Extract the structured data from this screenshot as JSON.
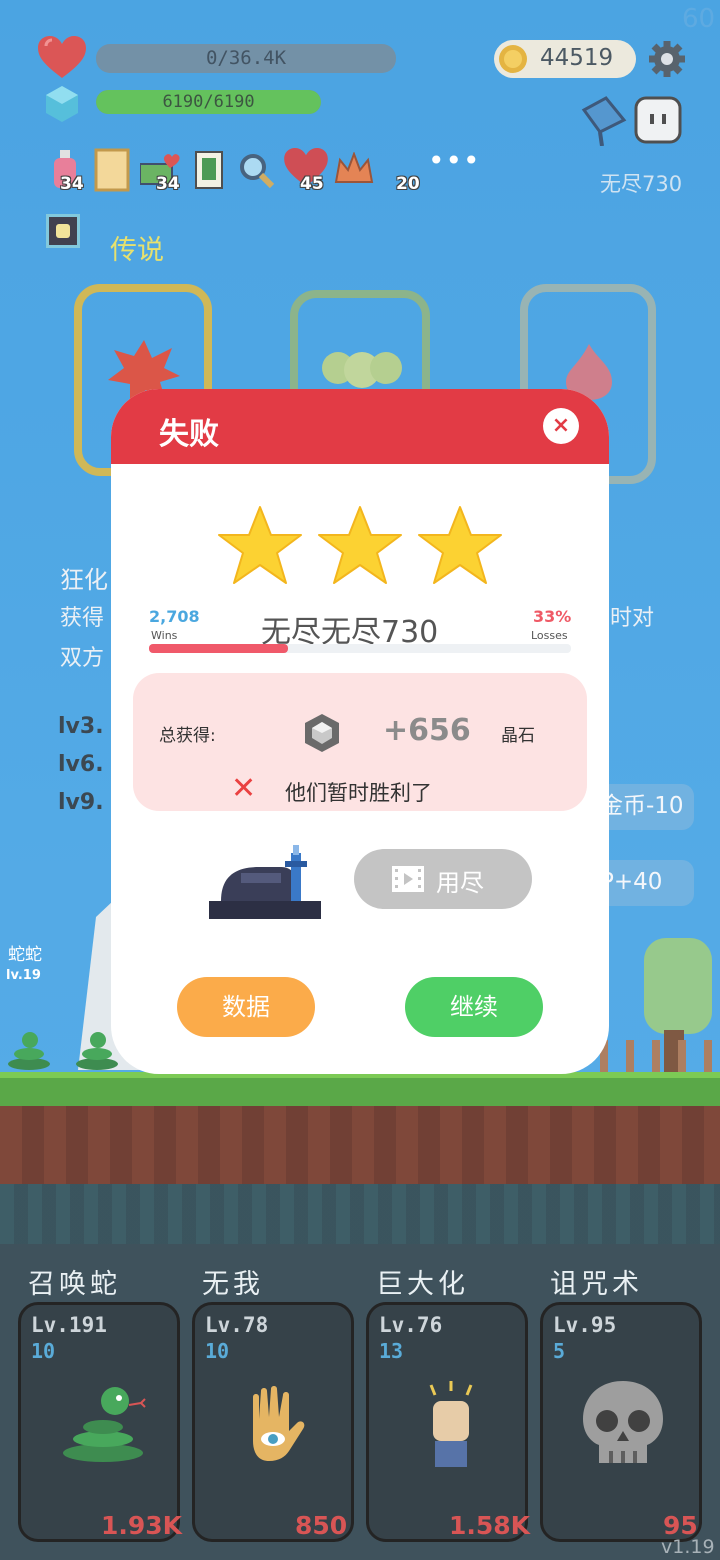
{
  "fps": "60",
  "version": "v1.19",
  "hud": {
    "hp_text": "0/36.4K",
    "hp_fill": 0,
    "crystal_text": "6190/6190",
    "crystal_fill": 1,
    "coins": "44519",
    "mode_label": "无尽730"
  },
  "items": [
    {
      "icon": "potion-icon",
      "count": "34"
    },
    {
      "icon": "scroll-icon",
      "count": ""
    },
    {
      "icon": "money-heart-icon",
      "count": "34"
    },
    {
      "icon": "card-icon",
      "count": ""
    },
    {
      "icon": "magnifier-icon",
      "count": ""
    },
    {
      "icon": "heart-icon",
      "count": "45"
    },
    {
      "icon": "crown-icon",
      "count": ""
    },
    {
      "icon": "more-icon",
      "count": "20"
    }
  ],
  "background": {
    "legend_label": "传说",
    "desc_title": "狂化",
    "desc_line1": "获得",
    "desc_line1_right": "时对",
    "desc_line2": "双方",
    "lv3": "lv3.",
    "lv6": "lv6.",
    "lv9": "lv9.",
    "side_pill_1": "金币-10",
    "side_pill_2": "P+40",
    "enemy_name": "蛇蛇",
    "enemy_lv": "lv.19"
  },
  "skills": [
    {
      "title": "召唤蛇",
      "lv": "Lv.191",
      "num": "10",
      "cost": "1.93K",
      "icon": "snake-icon"
    },
    {
      "title": "无我",
      "lv": "Lv.78",
      "num": "10",
      "cost": "850",
      "icon": "eye-hand-icon"
    },
    {
      "title": "巨大化",
      "lv": "Lv.76",
      "num": "13",
      "cost": "1.58K",
      "icon": "fist-icon"
    },
    {
      "title": "诅咒术",
      "lv": "Lv.95",
      "num": "5",
      "cost": "95",
      "icon": "skull-icon"
    }
  ],
  "dialog": {
    "title": "失败",
    "close_label": "×",
    "stars": 3,
    "wins_num": "2,708",
    "wins_label": "Wins",
    "losses_pct": "33%",
    "losses_label": "Losses",
    "mode_name": "无尽无尽730",
    "win_ratio": 0.33,
    "reward_label": "总获得:",
    "reward_amount": "+656",
    "reward_unit": "晶石",
    "fail_message": "他们暂时胜利了",
    "video_button": "用尽",
    "data_button": "数据",
    "continue_button": "继续"
  },
  "colors": {
    "header_red": "#e23b45",
    "continue_green": "#4fcf66",
    "data_orange": "#fbab4a",
    "sky_blue": "#2e95de"
  }
}
